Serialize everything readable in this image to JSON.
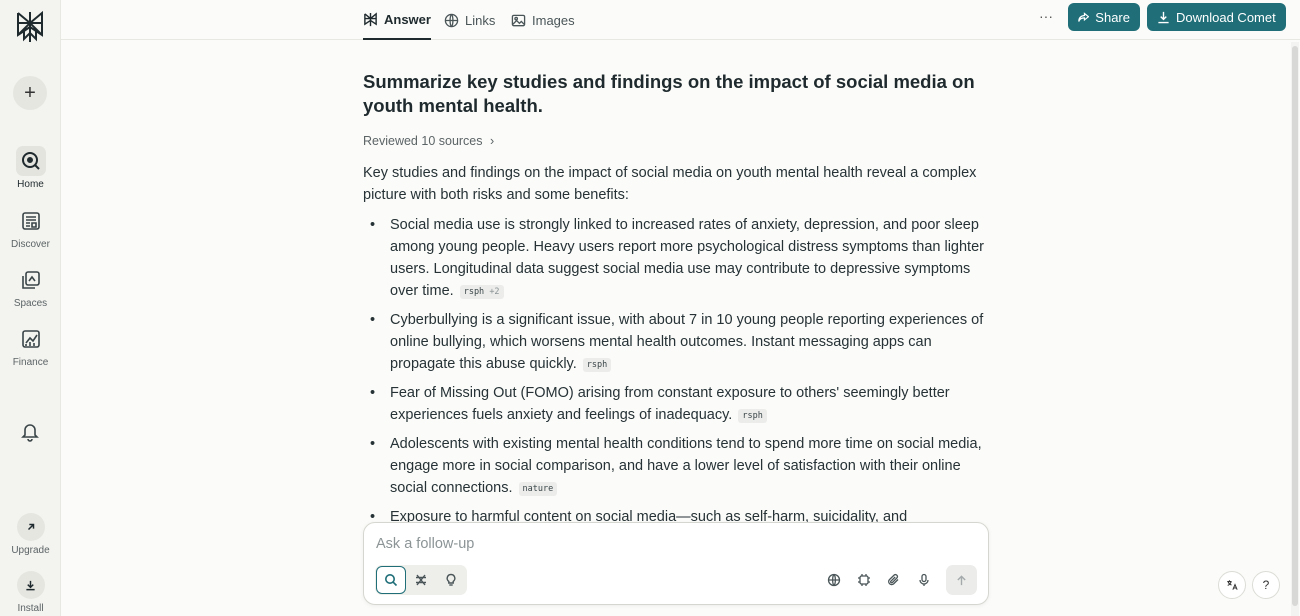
{
  "sidebar": {
    "items": [
      {
        "label": "Home",
        "icon": "search-circle-icon"
      },
      {
        "label": "Discover",
        "icon": "newspaper-icon"
      },
      {
        "label": "Spaces",
        "icon": "spaces-icon"
      },
      {
        "label": "Finance",
        "icon": "chart-icon"
      }
    ],
    "upgrade_label": "Upgrade",
    "install_label": "Install"
  },
  "tabs": [
    {
      "label": "Answer",
      "icon": "perplexity-icon"
    },
    {
      "label": "Links",
      "icon": "globe-icon"
    },
    {
      "label": "Images",
      "icon": "image-icon"
    }
  ],
  "header": {
    "more_label": "···",
    "share_label": "Share",
    "download_label": "Download Comet"
  },
  "answer": {
    "title": "Summarize key studies and findings on the impact of social media on youth mental health.",
    "reviewed": "Reviewed 10 sources",
    "intro": "Key studies and findings on the impact of social media on youth mental health reveal a complex picture with both risks and some benefits:",
    "findings": [
      {
        "text": "Social media use is strongly linked to increased rates of anxiety, depression, and poor sleep among young people. Heavy users report more psychological distress symptoms than lighter users. Longitudinal data suggest social media use may contribute to depressive symptoms over time.",
        "cite": "rsph",
        "cite_extra": "+2"
      },
      {
        "text": "Cyberbullying is a significant issue, with about 7 in 10 young people reporting experiences of online bullying, which worsens mental health outcomes. Instant messaging apps can propagate this abuse quickly.",
        "cite": "rsph"
      },
      {
        "text": "Fear of Missing Out (FOMO) arising from constant exposure to others' seemingly better experiences fuels anxiety and feelings of inadequacy.",
        "cite": "rsph"
      },
      {
        "text": "Adolescents with existing mental health conditions tend to spend more time on social media, engage more in social comparison, and have a lower level of satisfaction with their online social connections.",
        "cite": "nature"
      },
      {
        "text": "Exposure to harmful content on social media—such as self-harm, suicidality, and"
      }
    ]
  },
  "followup": {
    "placeholder": "Ask a follow-up"
  },
  "colors": {
    "accent": "#1f6e78",
    "background": "#fbfbf9",
    "sidebar": "#f3f3ef"
  }
}
